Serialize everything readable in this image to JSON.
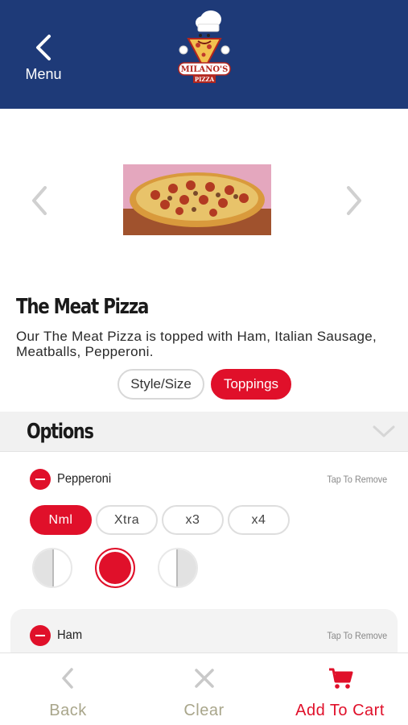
{
  "header": {
    "back_label": "Menu",
    "logo_text_top": "MILANO'S",
    "logo_text_bottom": "PIZZA",
    "background": "#1e3a78"
  },
  "product": {
    "title": "The Meat Pizza",
    "description": "Our The Meat Pizza is topped with Ham, Italian Sausage, Meatballs, Pepperoni."
  },
  "tabs": [
    {
      "label": "Style/Size",
      "active": false
    },
    {
      "label": "Toppings",
      "active": true
    }
  ],
  "options": {
    "title": "Options",
    "toppings": [
      {
        "name": "Pepperoni",
        "remove_label": "Tap To Remove",
        "amounts": [
          "Nml",
          "Xtra",
          "x3",
          "x4"
        ],
        "selected_amount": "Nml",
        "portions": [
          "left-half",
          "whole",
          "right-half"
        ],
        "selected_portion": "whole"
      },
      {
        "name": "Ham",
        "remove_label": "Tap To Remove"
      }
    ]
  },
  "bottom_nav": {
    "back": "Back",
    "clear": "Clear",
    "add_to_cart": "Add To Cart"
  },
  "colors": {
    "accent": "#e0102a",
    "header": "#1e3a78",
    "muted_nav": "#a9a68b"
  }
}
